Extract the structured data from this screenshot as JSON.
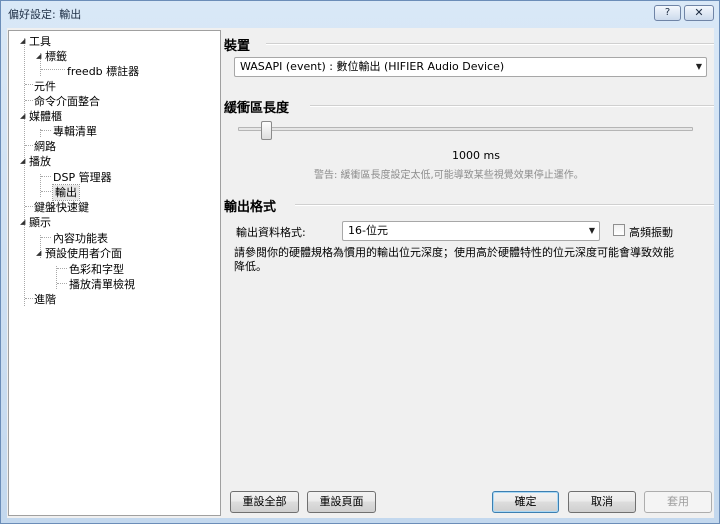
{
  "window": {
    "title": "偏好設定: 輸出",
    "help_label": "?",
    "close_label": "✕"
  },
  "tree": {
    "items": [
      {
        "label": "工具",
        "level": 0,
        "expanded": true
      },
      {
        "label": "標籤",
        "level": 1,
        "expanded": true
      },
      {
        "label": "freedb 標註器",
        "level": 2
      },
      {
        "label": "元件",
        "level": 0
      },
      {
        "label": "命令介面整合",
        "level": 0
      },
      {
        "label": "媒體櫃",
        "level": 0,
        "expanded": true
      },
      {
        "label": "專輯清單",
        "level": 1
      },
      {
        "label": "網路",
        "level": 0
      },
      {
        "label": "播放",
        "level": 0,
        "expanded": true
      },
      {
        "label": "DSP 管理器",
        "level": 1
      },
      {
        "label": "輸出",
        "level": 1,
        "selected": true
      },
      {
        "label": "鍵盤快速鍵",
        "level": 0
      },
      {
        "label": "顯示",
        "level": 0,
        "expanded": true
      },
      {
        "label": "內容功能表",
        "level": 1
      },
      {
        "label": "預設使用者介面",
        "level": 1,
        "expanded": true
      },
      {
        "label": "色彩和字型",
        "level": 2
      },
      {
        "label": "播放清單檢視",
        "level": 2
      },
      {
        "label": "進階",
        "level": 0
      }
    ]
  },
  "device": {
    "header": "裝置",
    "selected": "WASAPI (event) : 數位輸出 (HIFIER Audio Device)"
  },
  "buffer": {
    "header": "緩衝區長度",
    "value_text": "1000 ms",
    "slider_fraction": 0.05,
    "warning": "警告: 緩衝區長度設定太低,可能導致某些視覺效果停止運作。"
  },
  "output_format": {
    "header": "輸出格式",
    "label": "輸出資料格式:",
    "selected": "16-位元",
    "dither_label": "高頻振動",
    "dither_checked": false,
    "note_line1": "請參閱你的硬體規格為慣用的輸出位元深度；使用高於硬體特性的位元深度可能會導致效能",
    "note_line2": "降低。"
  },
  "buttons": {
    "reset_all": "重設全部",
    "reset_page": "重設頁面",
    "ok": "確定",
    "cancel": "取消",
    "apply": "套用"
  }
}
